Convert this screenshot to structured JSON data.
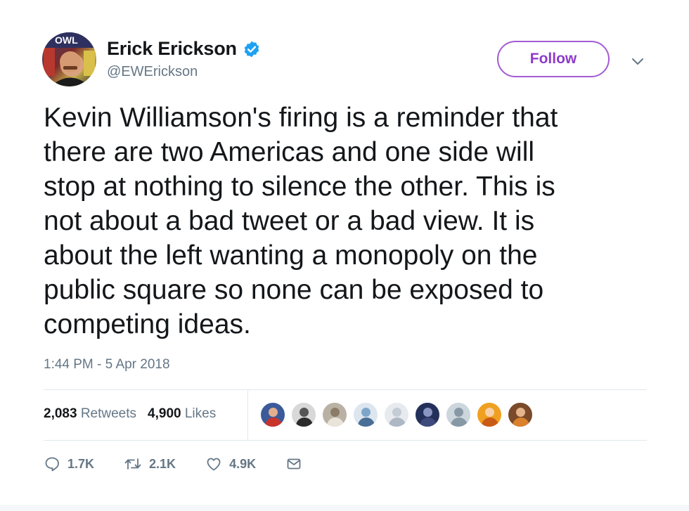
{
  "tweet": {
    "author": {
      "display_name": "Erick Erickson",
      "handle": "@EWErickson",
      "verified": true
    },
    "follow_label": "Follow",
    "text_lines": [
      "Kevin Williamson's firing is a reminder that",
      "there are two Americas and one side will",
      "stop at nothing to silence the other. This is",
      "not about a bad tweet or a bad view. It is",
      "about the left wanting a monopoly on the",
      "public square so none can be exposed to",
      "competing ideas."
    ],
    "timestamp": "1:44 PM - 5 Apr 2018",
    "stats": {
      "retweets_count": "2,083",
      "retweets_label": "Retweets",
      "likes_count": "4,900",
      "likes_label": "Likes"
    },
    "actions": {
      "replies": "1.7K",
      "retweets": "2.1K",
      "likes": "4.9K"
    }
  },
  "colors": {
    "follow_accent": "#8e3bc8",
    "verified_blue": "#1da1f2",
    "meta_gray": "#657786"
  },
  "icons": [
    "verified-badge-icon",
    "chevron-down-icon",
    "reply-icon",
    "retweet-icon",
    "like-icon",
    "message-icon"
  ]
}
